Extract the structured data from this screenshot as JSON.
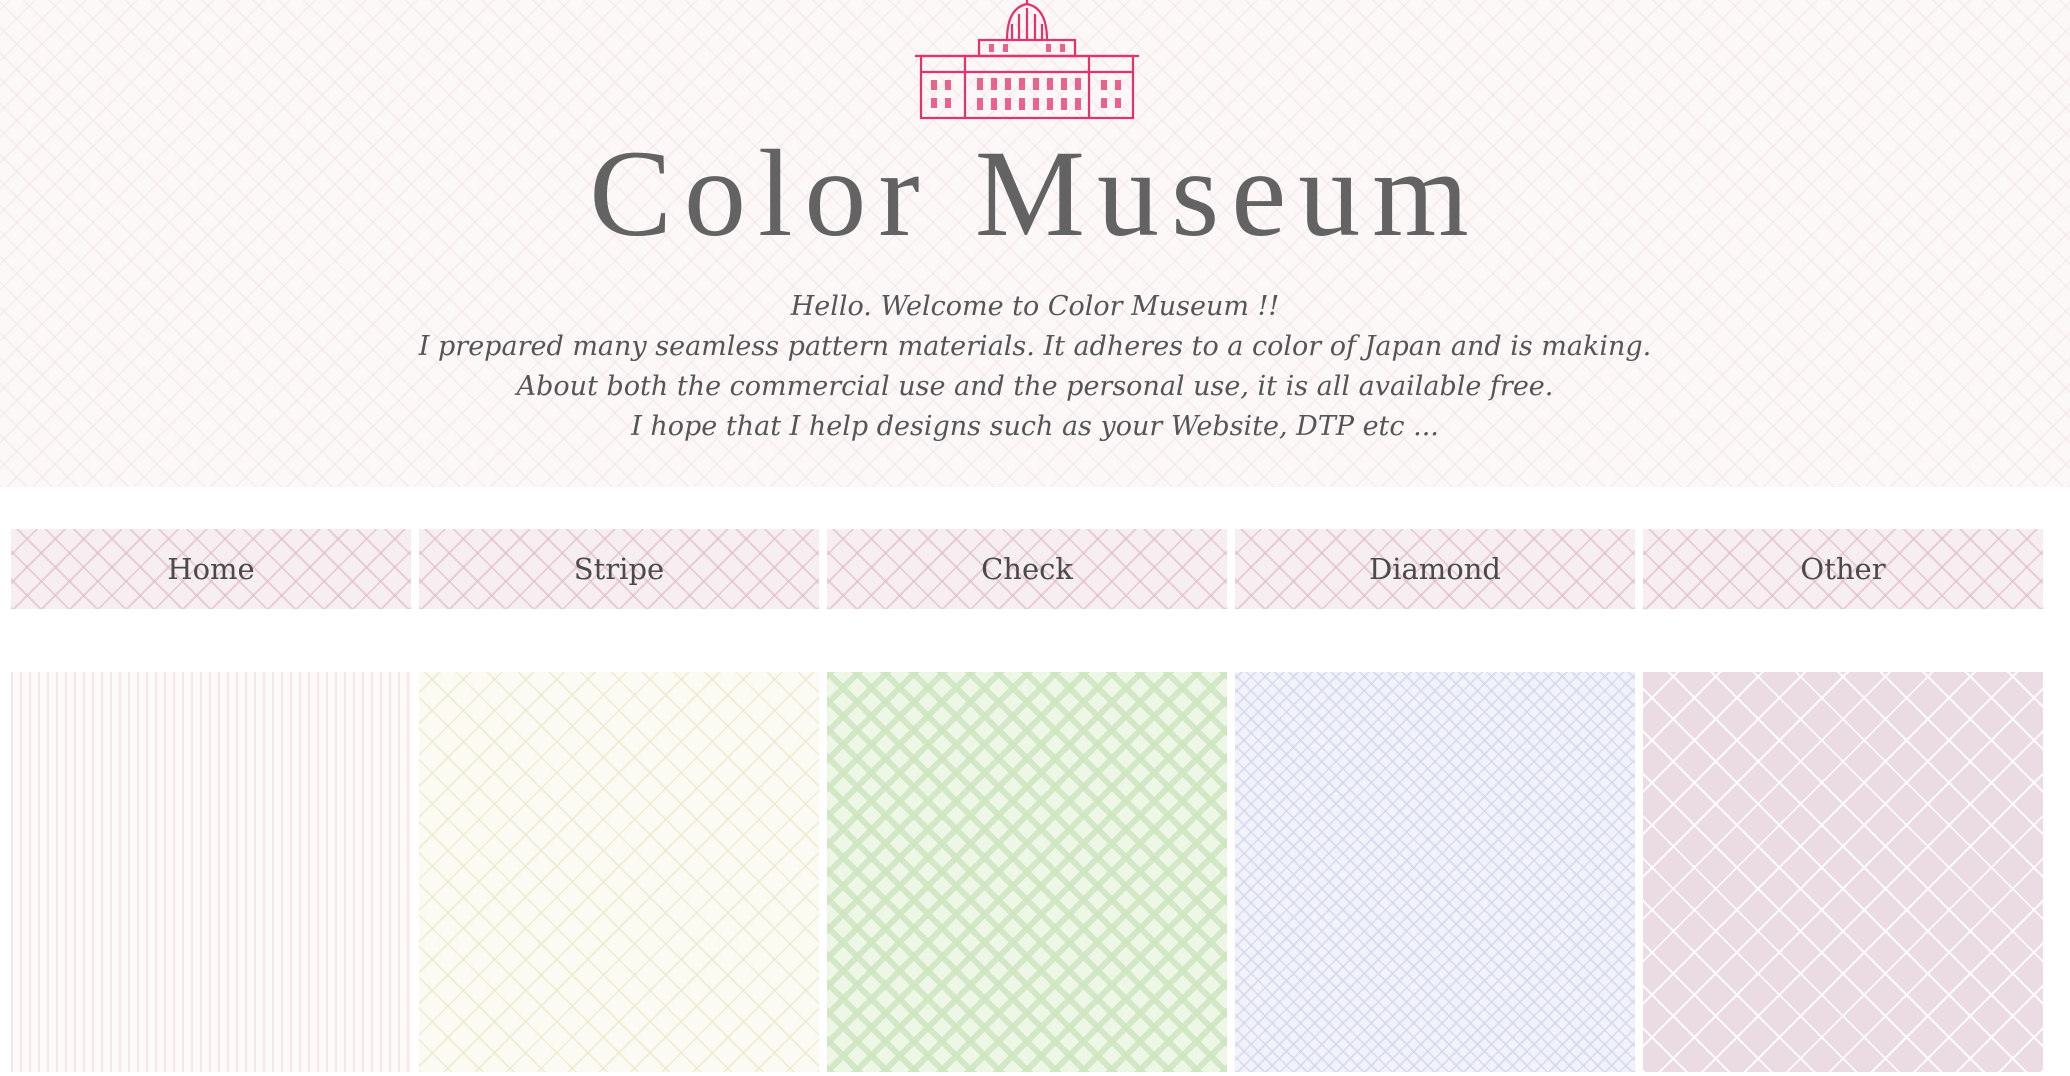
{
  "site": {
    "title": "Color Museum",
    "logo_icon": "museum-building-stamp-icon",
    "accent_color": "#e8306a"
  },
  "intro": {
    "lines": [
      "Hello. Welcome to Color Museum !!",
      "I prepared many seamless pattern materials. It adheres to a color of Japan and is making.",
      "About both the commercial use and the personal use, it is all available free.",
      "I hope that I help designs such as your Website, DTP etc ..."
    ]
  },
  "nav": {
    "items": [
      {
        "label": "Home"
      },
      {
        "label": "Stripe"
      },
      {
        "label": "Check"
      },
      {
        "label": "Diamond"
      },
      {
        "label": "Other"
      }
    ]
  },
  "patterns": [
    {
      "name": "pink-stripe-pattern",
      "color": "#f0d6da"
    },
    {
      "name": "cream-diamond-pattern",
      "color": "#ebe6c8"
    },
    {
      "name": "green-check-pattern",
      "color": "#cee6c0"
    },
    {
      "name": "lavender-diamond-pattern",
      "color": "#d2d6ec"
    },
    {
      "name": "pink-lattice-pattern",
      "color": "#ebdce3"
    }
  ]
}
